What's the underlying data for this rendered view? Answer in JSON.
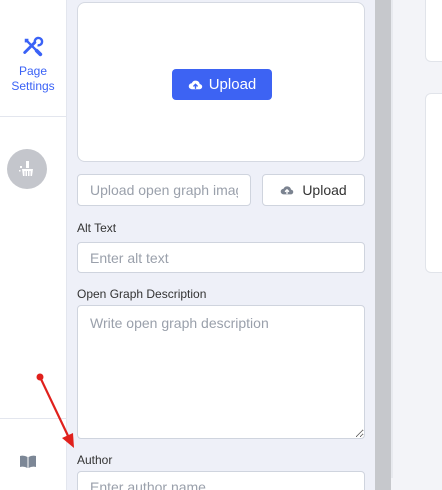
{
  "sidebar": {
    "page_settings_label": "Page Settings"
  },
  "upload": {
    "primary_label": "Upload",
    "og_image_placeholder": "Upload open graph image",
    "secondary_label": "Upload"
  },
  "alt_text": {
    "label": "Alt Text",
    "placeholder": "Enter alt text"
  },
  "og_description": {
    "label": "Open Graph Description",
    "placeholder": "Write open graph description"
  },
  "author": {
    "label": "Author",
    "placeholder": "Enter author name"
  },
  "colors": {
    "accent": "#3d63f3",
    "annotation_arrow": "#e0201c"
  },
  "icons": {
    "page_settings": "wrench-screwdriver-icon",
    "cleanup": "broom-icon",
    "upload": "cloud-upload-icon",
    "docs": "book-icon",
    "resize": "resize-grip-icon"
  }
}
